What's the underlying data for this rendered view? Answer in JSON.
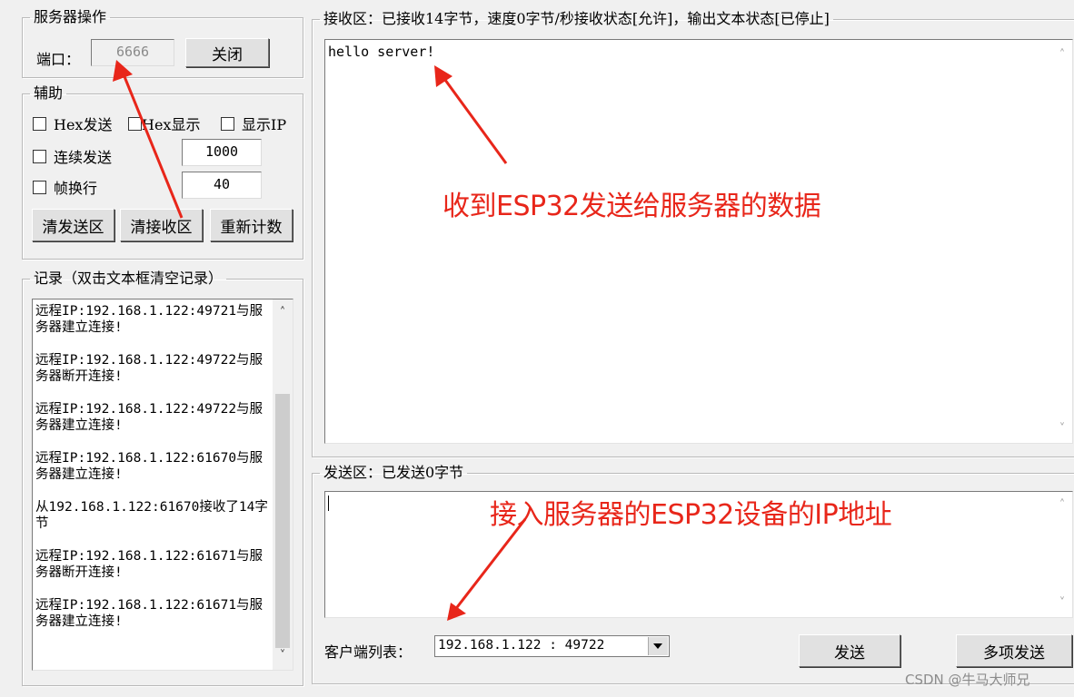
{
  "server": {
    "group_title": "服务器操作",
    "port_label": "端口：",
    "port_value": "6666",
    "close_label": "关闭"
  },
  "assist": {
    "group_title": "辅助",
    "hex_send": "Hex发送",
    "hex_display": "Hex显示",
    "show_ip": "显示IP",
    "continuous_send": "连续发送",
    "continuous_interval": "1000",
    "frame_newline": "帧换行",
    "frame_value": "40",
    "clear_send": "清发送区",
    "clear_receive": "清接收区",
    "reset_count": "重新计数"
  },
  "log": {
    "group_title": "记录（双击文本框清空记录）",
    "entries": [
      "远程IP:192.168.1.122:49721与服务器建立连接!",
      "远程IP:192.168.1.122:49722与服务器断开连接!",
      "远程IP:192.168.1.122:49722与服务器建立连接!",
      "远程IP:192.168.1.122:61670与服务器建立连接!",
      "从192.168.1.122:61670接收了14字节",
      "远程IP:192.168.1.122:61671与服务器断开连接!",
      "远程IP:192.168.1.122:61671与服务器建立连接!"
    ]
  },
  "receive": {
    "group_title": "接收区：已接收14字节，速度0字节/秒接收状态[允许]，输出文本状态[已停止]",
    "content": "hello server!"
  },
  "send": {
    "group_title": "发送区：已发送0字节",
    "client_list_label": "客户端列表：",
    "client_selected": "192.168.1.122 : 49722",
    "send_button": "发送",
    "multi_send_button": "多项发送"
  },
  "annotations": {
    "receive_note": "收到ESP32发送给服务器的数据",
    "ip_note": "接入服务器的ESP32设备的IP地址",
    "color": "#e8261a"
  },
  "watermark": "CSDN @牛马大师兄"
}
